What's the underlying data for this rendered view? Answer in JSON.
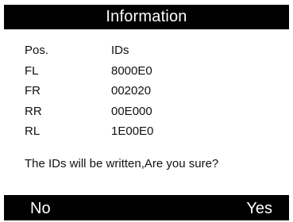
{
  "dialog": {
    "title": "Information",
    "headers": {
      "pos": "Pos.",
      "ids": "IDs"
    },
    "rows": [
      {
        "pos": "FL",
        "ids": "8000E0"
      },
      {
        "pos": "FR",
        "ids": "002020"
      },
      {
        "pos": "RR",
        "ids": "00E000"
      },
      {
        "pos": "RL",
        "ids": "1E00E0"
      }
    ],
    "message": "The IDs will be written,Are you sure?"
  },
  "softkeys": {
    "left": "No",
    "right": "Yes"
  },
  "colors": {
    "bar_background": "#000000",
    "bar_text": "#ffffff",
    "content_background": "#ffffff",
    "content_text": "#111111"
  }
}
